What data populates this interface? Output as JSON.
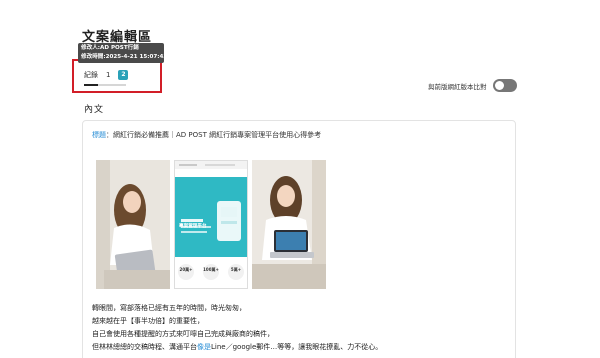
{
  "page": {
    "title": "文案編輯區"
  },
  "tooltip": {
    "editor": "修改人:AD POST行銷",
    "time": "修改時間:2025-4-21 15:07:43"
  },
  "versions": {
    "label": "紀錄",
    "v1": "1",
    "v2": "2"
  },
  "compare": {
    "label": "與前版網紅版本比對",
    "enabled": false
  },
  "section": {
    "title": "內文"
  },
  "post": {
    "title_prefix": "標題",
    "title_sep": "：",
    "title_text": "網紅行銷必備推薦｜AD POST 網紅行銷專案管理平台使用心得參考",
    "lines": [
      "轉眼間，寫部落格已經有五年的時間，時光匆匆，",
      "越來越在乎【事半功倍】的重要性，",
      "自己會使用各種提醒的方式來叮嚀自己完成與廠商的稿件，"
    ],
    "last_line_a": "但林林總總的交稿時程、溝通平台",
    "last_line_hl": "像是",
    "last_line_b": "Line／google郵件…等等，讓我眼花撩亂、力不從心。"
  },
  "photo2": {
    "heading": "專案管理平台",
    "stats": [
      "20萬+",
      "100萬+",
      "5萬+"
    ]
  },
  "colors": {
    "accent": "#2aa1b8",
    "link": "#2b8fd6",
    "highlight_border": "#d21e28"
  }
}
